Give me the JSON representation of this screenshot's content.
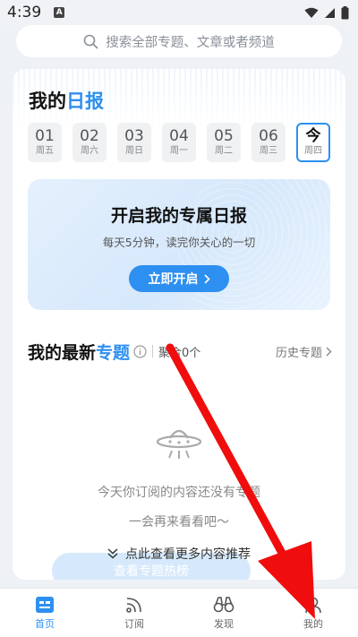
{
  "status_bar": {
    "time": "4:39",
    "notification_badge": "A"
  },
  "search": {
    "placeholder": "搜索全部专题、文章或者频道"
  },
  "daily": {
    "title_prefix": "我的",
    "title_highlight": "日报",
    "dates": [
      {
        "num": "01",
        "weekday": "周五"
      },
      {
        "num": "02",
        "weekday": "周六"
      },
      {
        "num": "03",
        "weekday": "周日"
      },
      {
        "num": "04",
        "weekday": "周一"
      },
      {
        "num": "05",
        "weekday": "周二"
      },
      {
        "num": "06",
        "weekday": "周三"
      },
      {
        "num": "今",
        "weekday": "周四"
      }
    ],
    "promo_title": "开启我的专属日报",
    "promo_subtitle": "每天5分钟，读完你关心的一切",
    "promo_button": "立即开启"
  },
  "topics": {
    "title_prefix": "我的最新",
    "title_highlight": "专题",
    "aggregate": "聚合0个",
    "history": "历史专题",
    "empty_line1": "今天你订阅的内容还没有专题",
    "empty_line2": "一会再来看看吧～",
    "more_link": "点此查看更多内容推荐",
    "hot_button": "查看专题热榜"
  },
  "bottom_nav": [
    {
      "label": "首页",
      "icon": "home-icon",
      "active": true
    },
    {
      "label": "订阅",
      "icon": "rss-icon",
      "active": false
    },
    {
      "label": "发现",
      "icon": "binoculars-icon",
      "active": false
    },
    {
      "label": "我的",
      "icon": "person-icon",
      "active": false
    }
  ],
  "colors": {
    "accent": "#2d8ff0",
    "arrow": "#f00d0d"
  }
}
